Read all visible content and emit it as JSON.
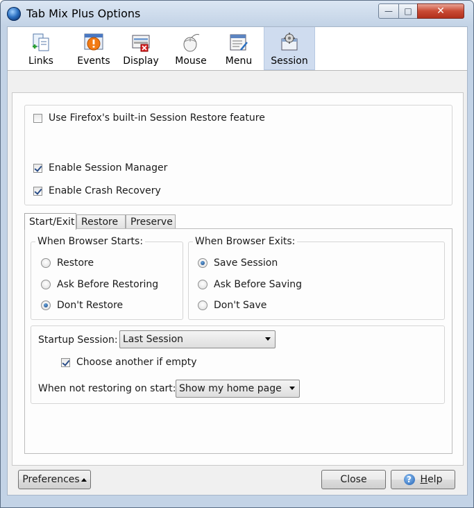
{
  "window": {
    "title": "Tab Mix Plus Options",
    "controls": {
      "minimize": "—",
      "maximize": "□",
      "close": "✕"
    }
  },
  "toolbar": {
    "items": [
      {
        "label": "Links",
        "icon": "links-icon"
      },
      {
        "label": "Events",
        "icon": "events-icon"
      },
      {
        "label": "Display",
        "icon": "display-icon"
      },
      {
        "label": "Mouse",
        "icon": "mouse-icon"
      },
      {
        "label": "Menu",
        "icon": "menu-icon"
      },
      {
        "label": "Session",
        "icon": "session-icon",
        "active": true
      }
    ]
  },
  "session": {
    "use_builtin": {
      "label": "Use Firefox's built-in Session Restore feature",
      "checked": false
    },
    "enable_manager": {
      "label": "Enable Session Manager",
      "checked": true
    },
    "enable_crash": {
      "label": "Enable Crash Recovery",
      "checked": true
    }
  },
  "tabs": [
    {
      "label": "Start/Exit",
      "active": true
    },
    {
      "label": "Restore"
    },
    {
      "label": "Preserve"
    }
  ],
  "starts": {
    "legend": "When Browser Starts:",
    "options": [
      {
        "label": "Restore",
        "checked": false
      },
      {
        "label": "Ask Before Restoring",
        "checked": false
      },
      {
        "label": "Don't Restore",
        "checked": true
      }
    ]
  },
  "exits": {
    "legend": "When Browser Exits:",
    "options": [
      {
        "label": "Save Session",
        "checked": true
      },
      {
        "label": "Ask Before Saving",
        "checked": false
      },
      {
        "label": "Don't Save",
        "checked": false
      }
    ]
  },
  "startup": {
    "label": "Startup Session:",
    "value": "Last Session",
    "choose_another": {
      "label": "Choose another if empty",
      "checked": true
    },
    "not_restoring_label": "When not restoring on start:",
    "not_restoring_value": "Show my home page"
  },
  "footer": {
    "preferences": "Preferences",
    "close": "Close",
    "help_prefix": "",
    "help_underlined": "H",
    "help_rest": "elp"
  },
  "colors": {
    "active_tab_bg": "#cfdcef",
    "close_button": "#c94a34",
    "title_gradient_top": "#dbe6f3"
  }
}
